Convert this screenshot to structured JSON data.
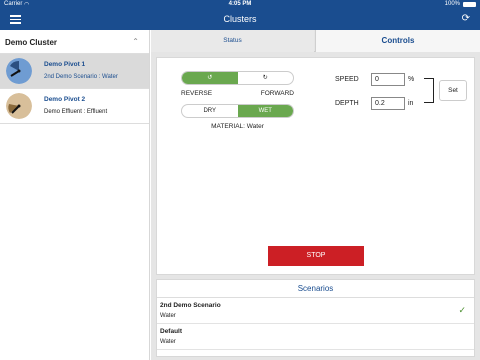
{
  "status_bar": {
    "carrier": "Carrier",
    "time": "4:05 PM",
    "battery": "100%"
  },
  "nav": {
    "title": "Clusters",
    "menu_icon": "hamburger-icon",
    "refresh_icon": "refresh-icon"
  },
  "sidebar": {
    "cluster_title": "Demo Cluster",
    "pivots": [
      {
        "name": "Demo Pivot 1",
        "sub": "2nd Demo Scenario : Water",
        "selected": true
      },
      {
        "name": "Demo Pivot 2",
        "sub": "Demo Effluent : Effluent",
        "selected": false
      }
    ]
  },
  "tabs": {
    "status": "Status",
    "controls": "Controls"
  },
  "controls": {
    "reverse_label": "REVERSE",
    "forward_label": "FORWARD",
    "direction_selected": "reverse",
    "dry_label": "DRY",
    "wet_label": "WET",
    "wet_selected": "wet",
    "material": "MATERIAL: Water",
    "speed_label": "SPEED",
    "speed_value": "0",
    "speed_unit": "%",
    "depth_label": "DEPTH",
    "depth_value": "0.2",
    "depth_unit": "in",
    "set_label": "Set",
    "stop_label": "STOP"
  },
  "scenarios": {
    "title": "Scenarios",
    "items": [
      {
        "name": "2nd Demo Scenario",
        "sub": "Water",
        "checked": true
      },
      {
        "name": "Default",
        "sub": "Water",
        "checked": false
      }
    ]
  },
  "colors": {
    "nav_blue": "#1a4d8f",
    "toggle_green": "#6aa84f",
    "stop_red": "#cc1f25"
  }
}
